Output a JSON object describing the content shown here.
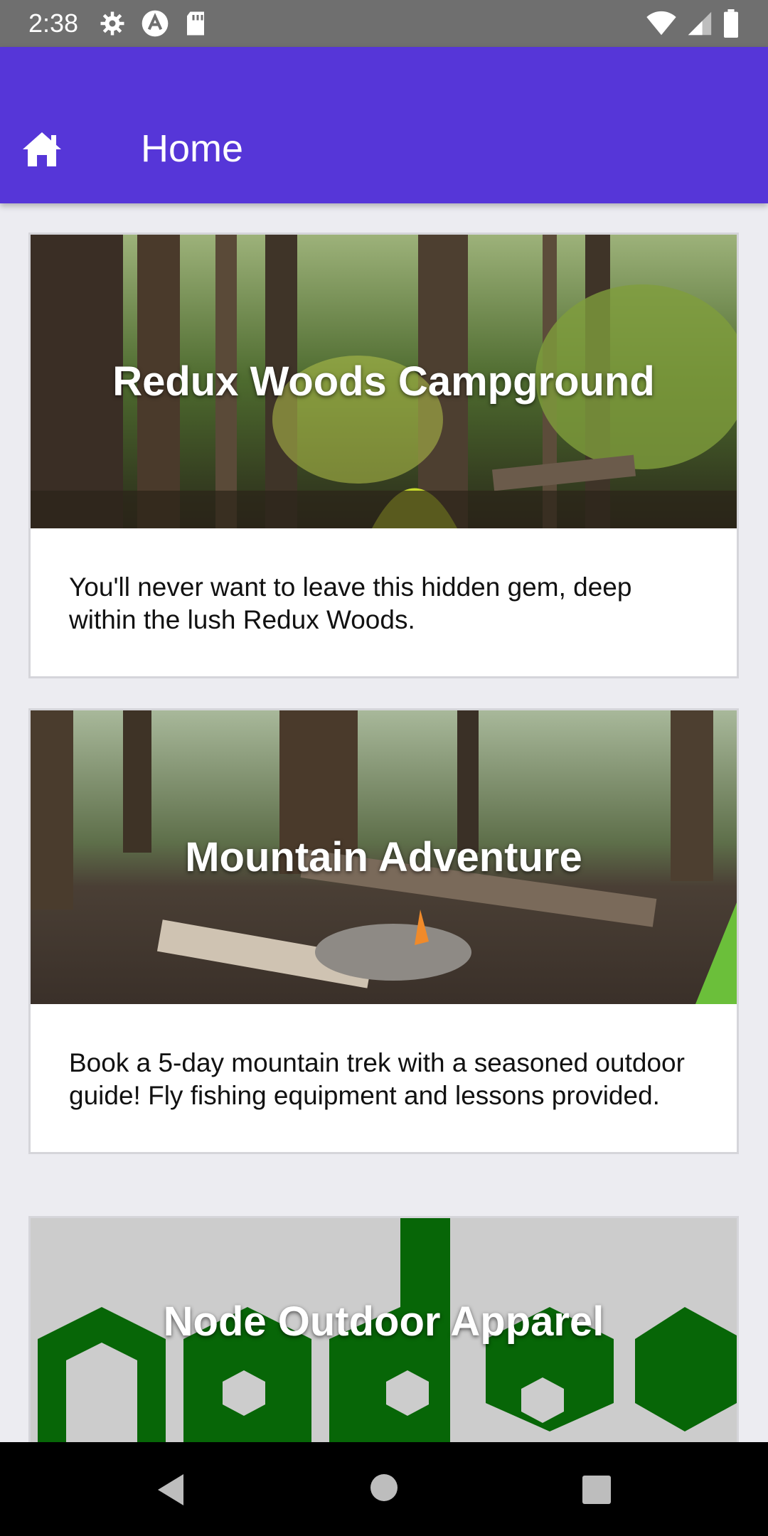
{
  "status_bar": {
    "time": "2:38",
    "left_icons": [
      "settings-icon",
      "app-logo-icon",
      "sd-card-icon"
    ],
    "right_icons": [
      "wifi-icon",
      "signal-icon",
      "battery-icon"
    ]
  },
  "app_bar": {
    "title": "Home",
    "icon": "home-icon",
    "color": "#5636D8"
  },
  "cards": [
    {
      "title": "Redux Woods Campground",
      "description": "You'll never want to leave this hidden gem, deep within the lush Redux Woods."
    },
    {
      "title": "Mountain Adventure",
      "description": "Book a 5-day mountain trek with a seasoned outdoor guide! Fly fishing equipment and lessons provided."
    },
    {
      "title": "Node Outdoor Apparel",
      "description": ""
    }
  ],
  "nav_bar": {
    "icons": [
      "back-icon",
      "home-circle-icon",
      "recents-icon"
    ]
  }
}
